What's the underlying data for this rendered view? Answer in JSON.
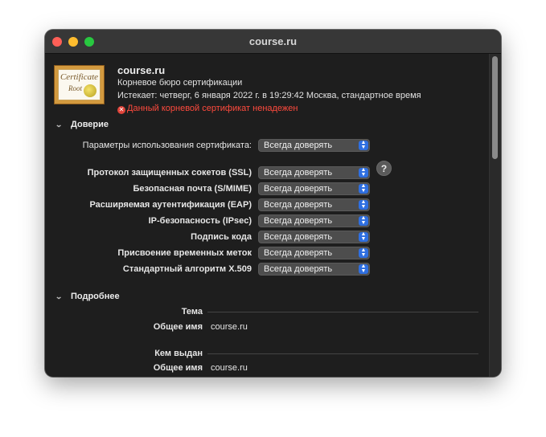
{
  "window": {
    "title": "course.ru"
  },
  "header": {
    "name": "course.ru",
    "kind": "Корневое бюро сертификации",
    "expires": "Истекает: четверг, 6 января 2022 г. в 19:29:42 Москва, стандартное время",
    "warning": "Данный корневой сертификат ненадежен",
    "icon_text": "Certificate",
    "icon_root": "Root"
  },
  "trust": {
    "section_title": "Доверие",
    "usage_label": "Параметры использования сертификата:",
    "usage_value": "Всегда доверять",
    "help_label": "?",
    "rows": [
      {
        "label": "Протокол защищенных сокетов (SSL)",
        "value": "Всегда доверять"
      },
      {
        "label": "Безопасная почта (S/MIME)",
        "value": "Всегда доверять"
      },
      {
        "label": "Расширяемая аутентификация (EAP)",
        "value": "Всегда доверять"
      },
      {
        "label": "IP-безопасность (IPsec)",
        "value": "Всегда доверять"
      },
      {
        "label": "Подпись кода",
        "value": "Всегда доверять"
      },
      {
        "label": "Присвоение временных меток",
        "value": "Всегда доверять"
      },
      {
        "label": "Стандартный алгоритм X.509",
        "value": "Всегда доверять"
      }
    ]
  },
  "details": {
    "section_title": "Подробнее",
    "subject_heading": "Тема",
    "subject_cn_label": "Общее имя",
    "subject_cn_value": "course.ru",
    "issuer_heading": "Кем выдан",
    "issuer_cn_label": "Общее имя",
    "issuer_cn_value": "course.ru"
  },
  "colors": {
    "warning": "#ff4a3d",
    "popup_accent": "#2f6fe0",
    "background": "#1e1e1e"
  },
  "icons": {
    "error": "x-circle-icon",
    "chevron": "chevron-down-icon",
    "popup": "updown-chevrons-icon"
  }
}
